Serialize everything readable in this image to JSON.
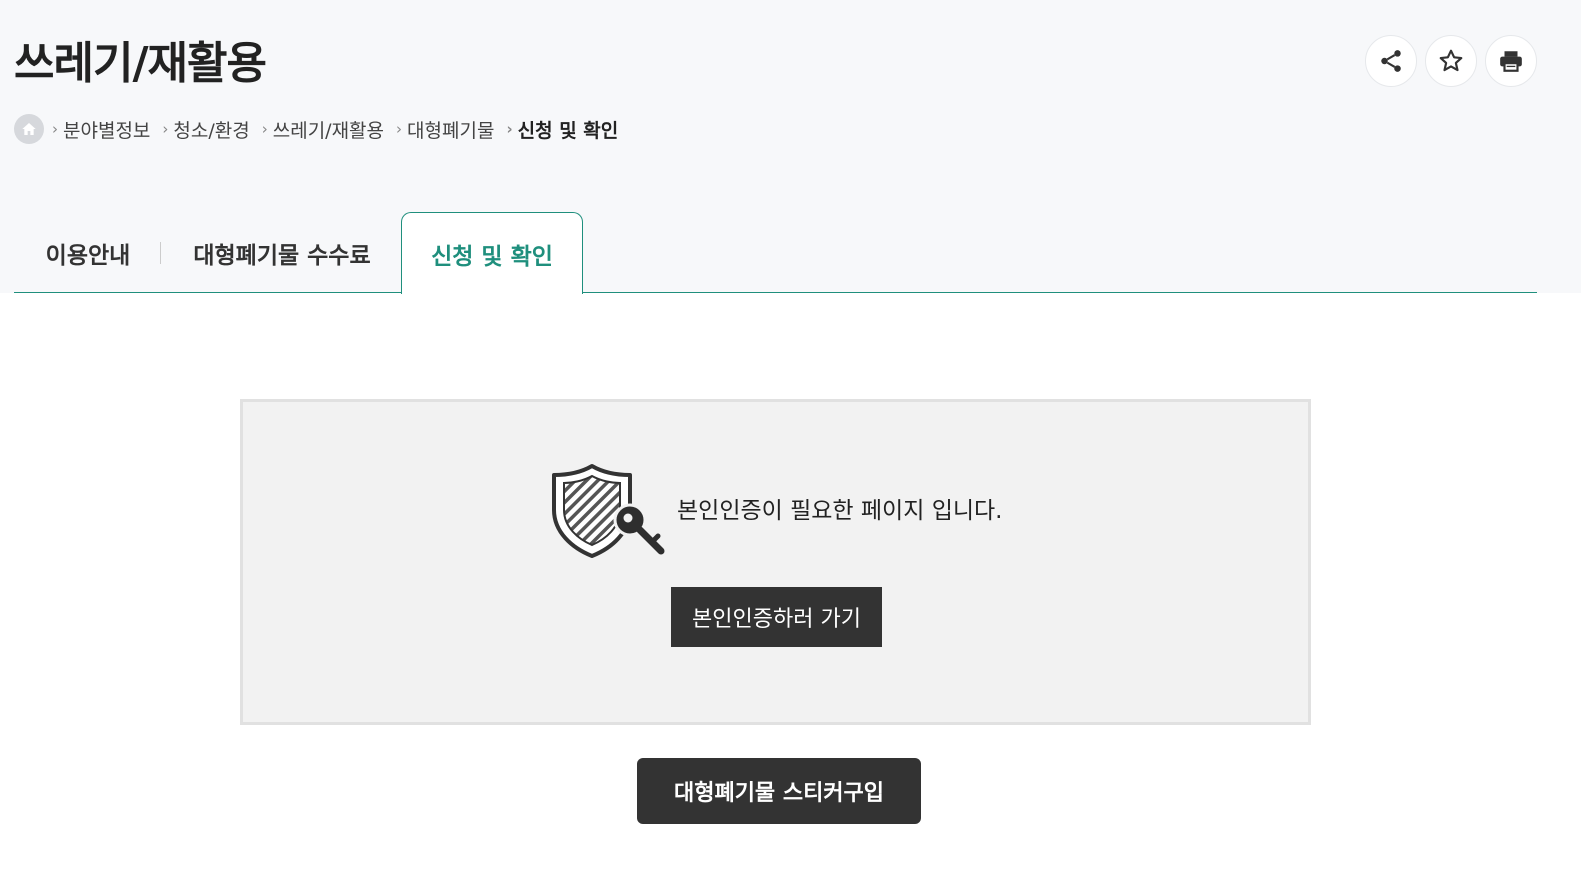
{
  "header": {
    "title": "쓰레기/재활용",
    "tools": [
      {
        "icon": "share-icon"
      },
      {
        "icon": "star-icon"
      },
      {
        "icon": "print-icon"
      }
    ]
  },
  "breadcrumb": {
    "home_icon": "home-icon",
    "items": [
      "분야별정보",
      "청소/환경",
      "쓰레기/재활용",
      "대형폐기물",
      "신청 및 확인"
    ]
  },
  "tabs": [
    {
      "label": "이용안내",
      "active": false
    },
    {
      "label": "대형폐기물 수수료",
      "active": false
    },
    {
      "label": "신청 및 확인",
      "active": true
    }
  ],
  "auth": {
    "icon": "shield-key-icon",
    "message": "본인인증이 필요한 페이지 입니다.",
    "button_label": "본인인증하러 가기"
  },
  "sticker_button_label": "대형폐기물 스티커구입",
  "colors": {
    "accent": "#1f8f7d",
    "dark_button": "#333333",
    "header_bg": "#f7f8fa",
    "box_bg": "#f2f2f2"
  }
}
